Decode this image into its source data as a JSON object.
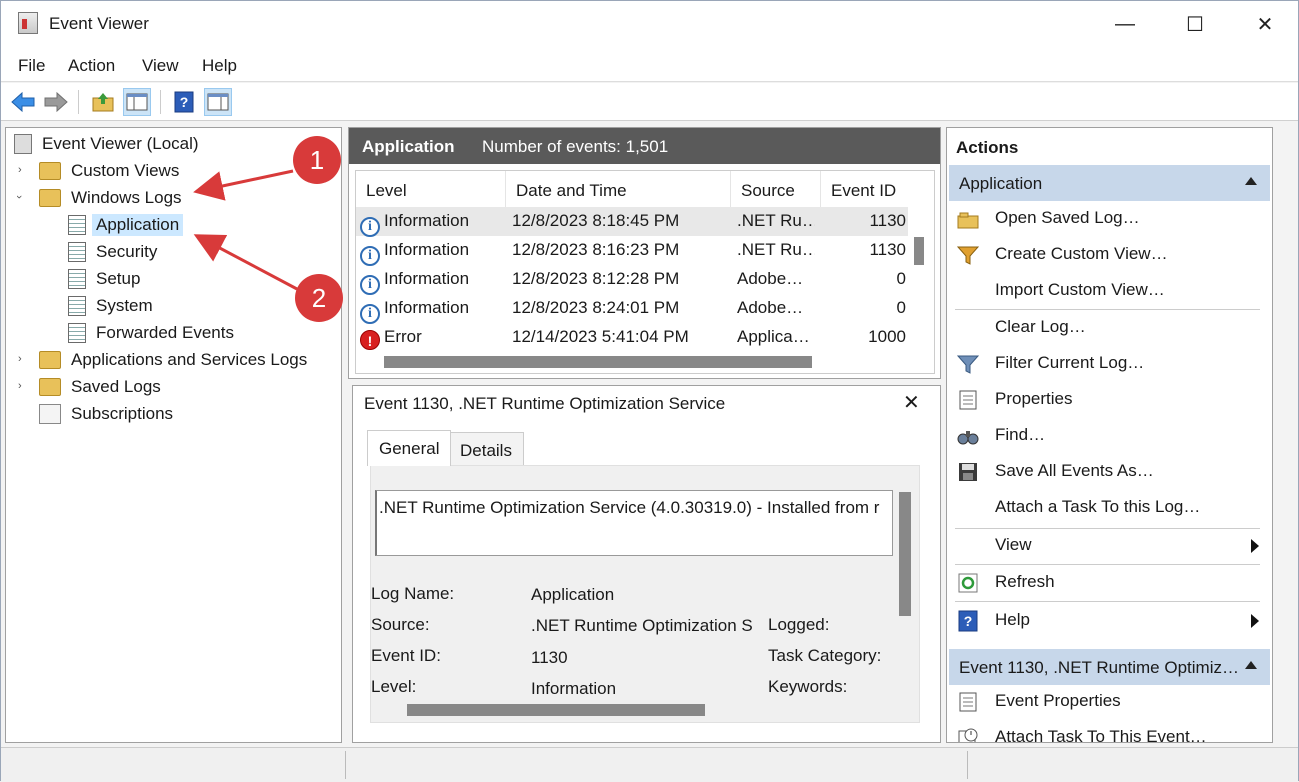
{
  "window": {
    "title": "Event Viewer",
    "minimize": "—",
    "maximize": "☐",
    "close": "✕"
  },
  "menu": [
    "File",
    "Action",
    "View",
    "Help"
  ],
  "toolbar": {
    "icons": [
      "back-icon",
      "forward-icon",
      "up-folder-icon",
      "show-hide-console-tree-icon",
      "help-icon",
      "show-hide-action-pane-icon"
    ]
  },
  "tree": {
    "root": "Event Viewer (Local)",
    "custom_views": "Custom Views",
    "windows_logs": "Windows Logs",
    "windows_children": [
      "Application",
      "Security",
      "Setup",
      "System",
      "Forwarded Events"
    ],
    "apps_services": "Applications and Services Logs",
    "saved_logs": "Saved Logs",
    "subscriptions": "Subscriptions",
    "callouts": [
      "1",
      "2"
    ]
  },
  "log": {
    "name": "Application",
    "count_label": "Number of events: 1,501",
    "columns": [
      "Level",
      "Date and Time",
      "Source",
      "Event ID"
    ],
    "rows": [
      {
        "level": "Information",
        "type": "info",
        "date": "12/8/2023 8:18:45 PM",
        "source": ".NET Ru…",
        "id": "1130"
      },
      {
        "level": "Information",
        "type": "info",
        "date": "12/8/2023 8:16:23 PM",
        "source": ".NET Ru…",
        "id": "1130"
      },
      {
        "level": "Information",
        "type": "info",
        "date": "12/8/2023 8:12:28 PM",
        "source": "Adobe…",
        "id": "0"
      },
      {
        "level": "Information",
        "type": "info",
        "date": "12/8/2023 8:24:01 PM",
        "source": "Adobe…",
        "id": "0"
      },
      {
        "level": "Error",
        "type": "error",
        "date": "12/14/2023 5:41:04 PM",
        "source": "Applica…",
        "id": "1000"
      }
    ]
  },
  "event": {
    "title": "Event 1130, .NET Runtime Optimization Service",
    "close": "✕",
    "tabs": [
      "General",
      "Details"
    ],
    "description": ".NET Runtime Optimization Service (4.0.30319.0) - Installed from r",
    "labels": [
      "Log Name:",
      "Source:",
      "Event ID:",
      "Level:"
    ],
    "values": [
      "Application",
      ".NET Runtime Optimization S",
      "1130",
      "Information"
    ],
    "labels2": [
      "Logged:",
      "Task Category:",
      "Keywords:"
    ]
  },
  "actions": {
    "header": "Actions",
    "section1": "Application",
    "items1": [
      {
        "label": "Open Saved Log…",
        "icon": "open-folder-icon"
      },
      {
        "label": "Create Custom View…",
        "icon": "funnel-icon"
      },
      {
        "label": "Import Custom View…",
        "icon": ""
      },
      {
        "label": "Clear Log…",
        "icon": ""
      },
      {
        "label": "Filter Current Log…",
        "icon": "filter-icon"
      },
      {
        "label": "Properties",
        "icon": "properties-icon"
      },
      {
        "label": "Find…",
        "icon": "binoculars-icon"
      },
      {
        "label": "Save All Events As…",
        "icon": "save-icon"
      },
      {
        "label": "Attach a Task To this Log…",
        "icon": ""
      },
      {
        "label": "View",
        "icon": ""
      },
      {
        "label": "Refresh",
        "icon": "refresh-icon"
      },
      {
        "label": "Help",
        "icon": "help-icon"
      }
    ],
    "section2": "Event 1130, .NET Runtime Optimiz…",
    "items2": [
      {
        "label": "Event Properties",
        "icon": "properties-icon"
      },
      {
        "label": "Attach Task To This Event…",
        "icon": "task-icon"
      }
    ]
  },
  "colors": {
    "accent": "#d83a3a",
    "selection": "#cce8ff",
    "header_dark": "#5a5a5a",
    "section_blue": "#c7d7ea"
  }
}
